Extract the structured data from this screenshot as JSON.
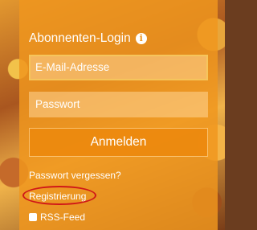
{
  "login": {
    "title": "Abonnenten-Login",
    "email_placeholder": "E-Mail-Adresse",
    "password_placeholder": "Passwort",
    "submit_label": "Anmelden",
    "forgot_label": "Passwort vergessen?",
    "register_label": "Registrierung",
    "rss_label": "RSS-Feed"
  },
  "colors": {
    "panel": "#f0961e",
    "highlight": "#d01818"
  },
  "icons": {
    "info": "info-icon",
    "rss": "rss-icon"
  }
}
